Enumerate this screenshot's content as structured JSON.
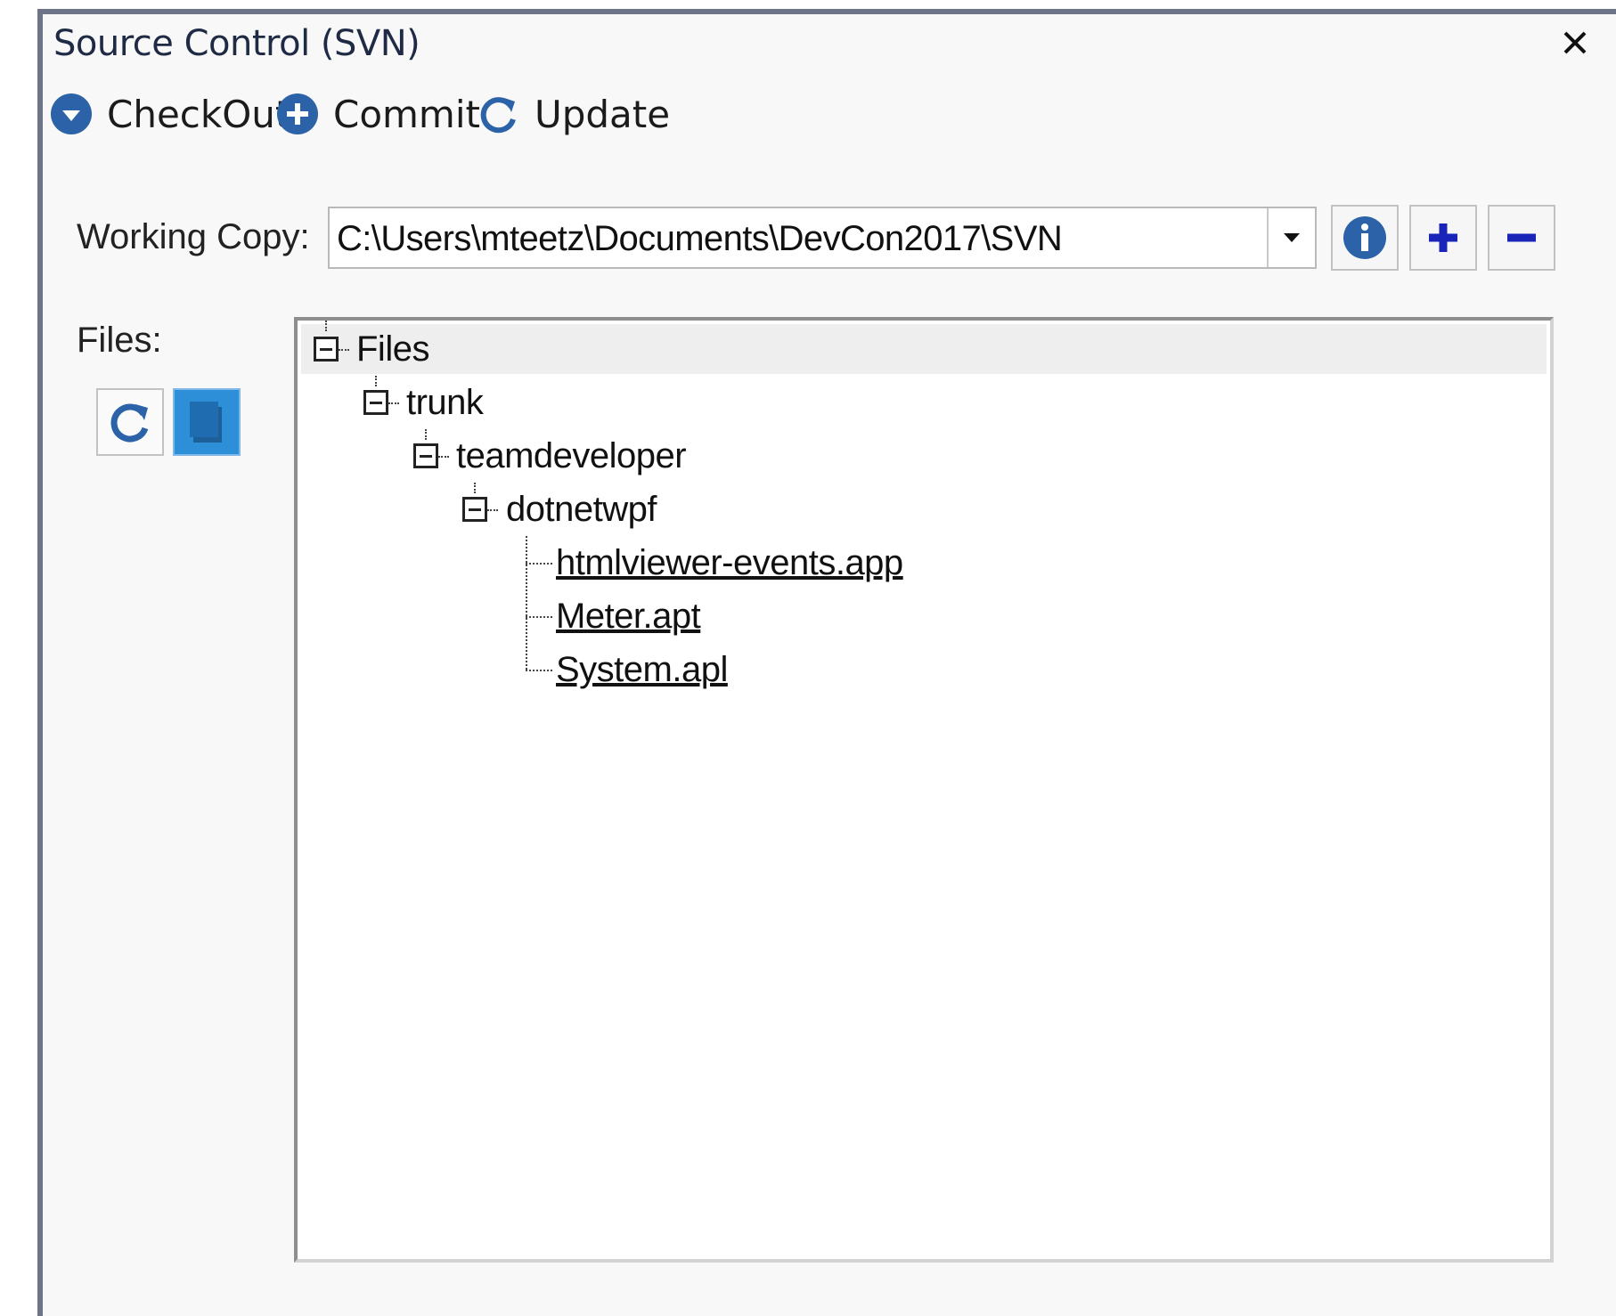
{
  "window": {
    "title": "Source Control (SVN)",
    "close_icon": "close-icon"
  },
  "toolbar": {
    "checkout_label": "CheckOut",
    "commit_label": "Commit",
    "update_label": "Update",
    "checkout_icon": "arrow-down-circle-icon",
    "commit_icon": "plus-circle-icon",
    "update_icon": "refresh-icon"
  },
  "working_copy": {
    "label": "Working Copy:",
    "value": "C:\\Users\\mteetz\\Documents\\DevCon2017\\SVN",
    "buttons": [
      "info-icon",
      "add-icon",
      "remove-icon"
    ]
  },
  "files": {
    "label": "Files:",
    "tool_icons": [
      "refresh-icon",
      "copy-icon"
    ],
    "tree": {
      "root": "Files",
      "trunk": "trunk",
      "teamdeveloper": "teamdeveloper",
      "dotnetwpf": "dotnetwpf",
      "items": [
        "htmlviewer-events.app",
        "Meter.apt",
        "System.apl"
      ]
    }
  },
  "colors": {
    "accent": "#2b62a8",
    "frame": "#6e7488",
    "selected": "#2d8fd8"
  }
}
